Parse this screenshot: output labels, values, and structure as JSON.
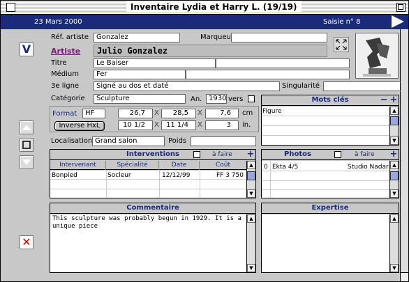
{
  "window": {
    "title": "Inventaire Lydia et Harry L. (19/19)"
  },
  "header": {
    "date": "23 Mars 2000",
    "saisie": "Saisie n° 8"
  },
  "form": {
    "ref_artiste_label": "Réf. artiste",
    "ref_artiste_value": "Gonzalez",
    "marqueur_label": "Marqueur",
    "marqueur_value": "",
    "artiste_label": "Artiste",
    "artiste_value": "Julio Gonzalez",
    "titre_label": "Titre",
    "titre_value": "Le Baiser",
    "titre_value2": "",
    "medium_label": "Médium",
    "medium_value": "Fer",
    "medium_value2": "",
    "ligne3_label": "3e ligne",
    "ligne3_value": "Signé au dos et daté",
    "singularite_label": "Singularité",
    "singularite_value": "",
    "categorie_label": "Catégorie",
    "categorie_value": "Sculpture",
    "an_label": "An.",
    "an_value": "1930",
    "vers_label": "vers",
    "format_label": "Format",
    "format_value": "HF",
    "dim_cm": [
      "26,7",
      "28,5",
      "7,6"
    ],
    "unit_cm": "cm",
    "inverse_button": "Inverse HxL",
    "dim_in": [
      "10 1/2",
      "11 1/4",
      "3"
    ],
    "unit_in": "in.",
    "localisation_label": "Localisation",
    "localisation_value": "Grand salon",
    "poids_label": "Poids",
    "poids_value": "",
    "mult_sign": "X"
  },
  "sidebar": {
    "v_label": "V",
    "delete_label": "✕"
  },
  "keywords": {
    "title": "Mots clés",
    "items": [
      "Figure"
    ]
  },
  "interventions": {
    "title": "Interventions",
    "a_faire": "à faire",
    "columns": [
      "Intervenant",
      "Spécialité",
      "Date",
      "Coût"
    ],
    "rows": [
      [
        "Bonpied",
        "Socleur",
        "12/12/99",
        "FF 3 750"
      ]
    ]
  },
  "photos": {
    "title": "Photos",
    "a_faire": "à faire",
    "rows": [
      [
        "0",
        "Ekta 4/5",
        "Studio Nadar"
      ]
    ]
  },
  "commentaire": {
    "title": "Commentaire",
    "text": "This sculpture was probably begun in 1929. It is a unique piece"
  },
  "expertise": {
    "title": "Expertise",
    "text": ""
  },
  "colors": {
    "header_bg": "#1c2a7a",
    "accent": "#1c2a7a",
    "link": "#7a1c7a",
    "delete": "#d00000"
  }
}
